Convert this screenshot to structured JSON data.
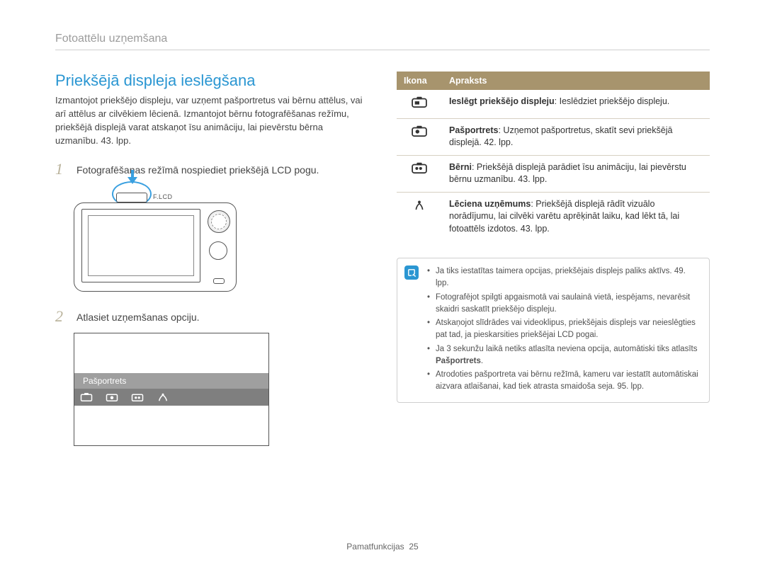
{
  "header": {
    "title": "Fotoattēlu uzņemšana"
  },
  "section": {
    "title": "Priekšējā displeja ieslēgšana",
    "intro": "Izmantojot priekšējo displeju, var uzņemt pašportretus vai bērnu attēlus, vai arī attēlus ar cilvēkiem lēcienā. Izmantojot bērnu fotografēšanas režīmu, priekšējā displejā varat atskaņot īsu animāciju, lai pievērstu bērna uzmanību. 43. lpp."
  },
  "step1": {
    "num": "1",
    "text": "Fotografēšanas režīmā nospiediet priekšējā LCD pogu."
  },
  "camera": {
    "button_label": "F.LCD"
  },
  "step2": {
    "num": "2",
    "text": "Atlasiet uzņemšanas opciju."
  },
  "menu": {
    "label": "Pašportrets"
  },
  "table": {
    "head_icon": "Ikona",
    "head_desc": "Apraksts",
    "rows": [
      {
        "icon": "front-off-icon",
        "bold": "Ieslēgt priekšējo displeju",
        "rest": ": Ieslēdziet priekšējo displeju."
      },
      {
        "icon": "self-portrait-icon",
        "bold": "Pašportrets",
        "rest": ": Uzņemot pašportretus, skatīt sevi priekšējā displejā. 42. lpp."
      },
      {
        "icon": "children-icon",
        "bold": "Bērni",
        "rest": ": Priekšējā displejā parādiet īsu animāciju, lai pievērstu bērnu uzmanību. 43. lpp."
      },
      {
        "icon": "jump-icon",
        "bold": "Lēciena uzņēmums",
        "rest": ": Priekšējā displejā rādīt vizuālo norādījumu, lai cilvēki varētu aprēķināt laiku, kad lēkt tā, lai fotoattēls izdotos. 43. lpp."
      }
    ]
  },
  "notes": {
    "items": [
      {
        "text": "Ja tiks iestatītas taimera opcijas, priekšējais displejs paliks aktīvs. 49. lpp."
      },
      {
        "text": "Fotografējot spilgti apgaismotā vai saulainā vietā, iespējams, nevarēsit skaidri saskatīt priekšējo displeju."
      },
      {
        "text": "Atskaņojot slīdrādes vai videoklipus, priekšējais displejs var neieslēgties pat tad, ja pieskarsities priekšējai LCD pogai."
      },
      {
        "text_pre": "Ja 3 sekunžu laikā netiks atlasīta neviena opcija, automātiski tiks atlasīts ",
        "bold": "Pašportrets",
        "text_post": "."
      },
      {
        "text": "Atrodoties pašportreta vai bērnu režīmā, kameru var iestatīt automātiskai aizvara atlaišanai, kad tiek atrasta smaidoša seja. 95. lpp."
      }
    ]
  },
  "footer": {
    "section": "Pamatfunkcijas",
    "page": "25"
  }
}
